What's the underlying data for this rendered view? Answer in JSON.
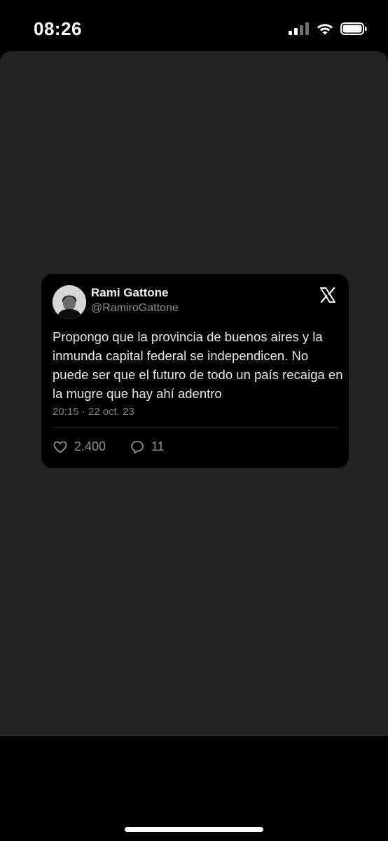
{
  "status_bar": {
    "time": "08:26",
    "icons": [
      "cellular-signal-icon",
      "wifi-icon",
      "battery-icon"
    ]
  },
  "tweet": {
    "name": "Rami Gattone",
    "handle": "@RamiroGattone",
    "text": "Propongo que la provincia de buenos aires y la inmunda capital federal se independicen. No puede ser que el futuro de todo un país recaiga en la mugre que hay ahí adentro",
    "timestamp": "20:15 · 22 oct. 23",
    "likes": "2.400",
    "replies": "11"
  },
  "colors": {
    "background": "#000000",
    "sheet": "#232323",
    "card": "#000000",
    "text_primary": "#e7e7e7",
    "text_secondary": "#8a8f94"
  }
}
